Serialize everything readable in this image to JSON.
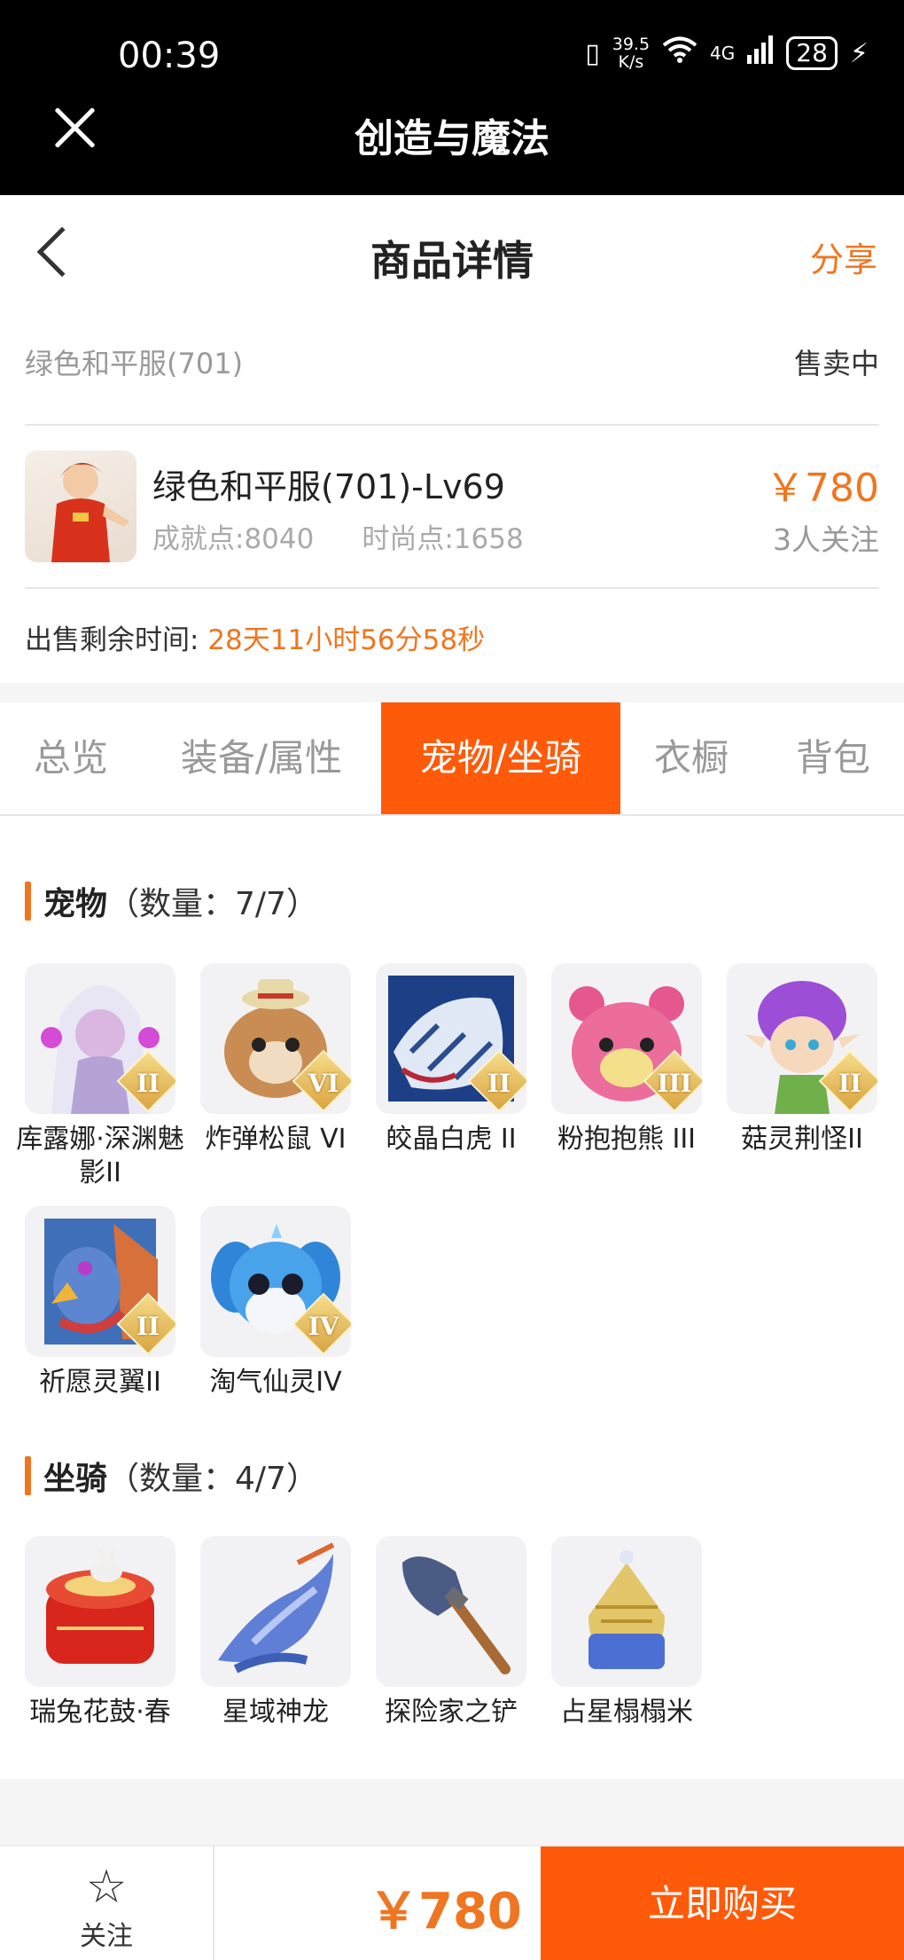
{
  "status_bar": {
    "time": "00:39",
    "net_speed_value": "39.5",
    "net_speed_unit": "K/s",
    "network": "4G",
    "battery": "28"
  },
  "app": {
    "title": "创造与魔法"
  },
  "header": {
    "title": "商品详情",
    "share_label": "分享"
  },
  "listing": {
    "server": "绿色和平服(701)",
    "status": "售卖中",
    "item_name": "绿色和平服(701)-Lv69",
    "achievement": "成就点:8040",
    "fashion": "时尚点:1658",
    "price": "￥780",
    "followers": "3人关注",
    "timer_label": "出售剩余时间:",
    "timer_value": "28天11小时56分58秒"
  },
  "tabs": [
    {
      "label": "总览",
      "active": false
    },
    {
      "label": "装备/属性",
      "active": false
    },
    {
      "label": "宠物/坐骑",
      "active": true
    },
    {
      "label": "衣橱",
      "active": false
    },
    {
      "label": "背包",
      "active": false
    }
  ],
  "pets": {
    "title": "宠物",
    "count": "（数量：7/7）",
    "items": [
      {
        "name": "库露娜·深渊魅影II",
        "badge": "II"
      },
      {
        "name": "炸弹松鼠 VI",
        "badge": "VI"
      },
      {
        "name": "皎晶白虎 II",
        "badge": "II"
      },
      {
        "name": "粉抱抱熊 III",
        "badge": "III"
      },
      {
        "name": "菇灵荆怪II",
        "badge": "II"
      },
      {
        "name": "祈愿灵翼II",
        "badge": "II"
      },
      {
        "name": "淘气仙灵IV",
        "badge": "IV"
      }
    ]
  },
  "mounts": {
    "title": "坐骑",
    "count": "（数量：4/7）",
    "items": [
      {
        "name": "瑞兔花鼓·春"
      },
      {
        "name": "星域神龙"
      },
      {
        "name": "探险家之铲"
      },
      {
        "name": "占星榻榻米"
      }
    ]
  },
  "bottom_bar": {
    "follow_label": "关注",
    "price": "￥780",
    "buy_label": "立即购买"
  }
}
